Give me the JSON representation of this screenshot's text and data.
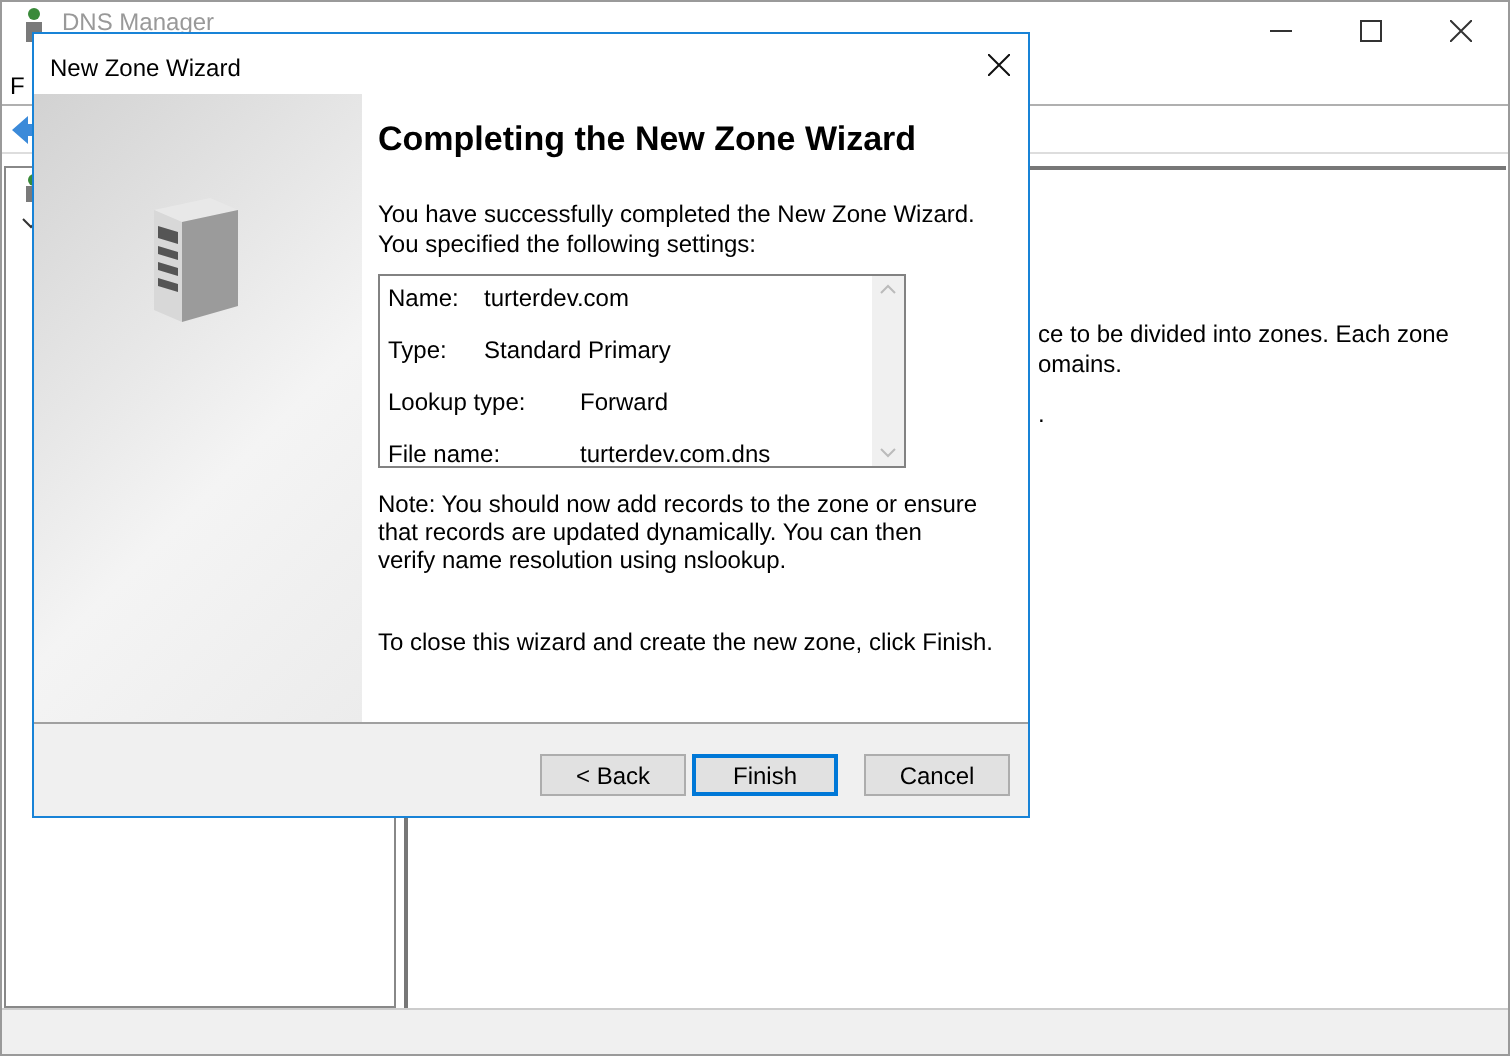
{
  "main_window": {
    "title": "DNS Manager",
    "menu_visible": "F",
    "details_lines": [
      "ce to be divided into zones. Each zone",
      "omains.",
      "."
    ]
  },
  "dialog": {
    "title": "New Zone Wizard",
    "heading": "Completing the New Zone Wizard",
    "intro": "You have successfully completed the New Zone Wizard. You specified the following settings:",
    "settings": [
      {
        "label": "Name:",
        "value": "turterdev.com"
      },
      {
        "label": "Type:",
        "value": "Standard Primary"
      },
      {
        "label": "Lookup type:",
        "value": "Forward"
      },
      {
        "label": "File name:",
        "value": "turterdev.com.dns"
      }
    ],
    "note": "Note: You should now add records to the zone or ensure that records are updated dynamically. You can then verify name resolution using nslookup.",
    "closing": "To close this wizard and create the new zone, click Finish.",
    "buttons": [
      {
        "label": "< Back",
        "default": false
      },
      {
        "label": "Finish",
        "default": true
      },
      {
        "label": "Cancel",
        "default": false
      }
    ]
  }
}
